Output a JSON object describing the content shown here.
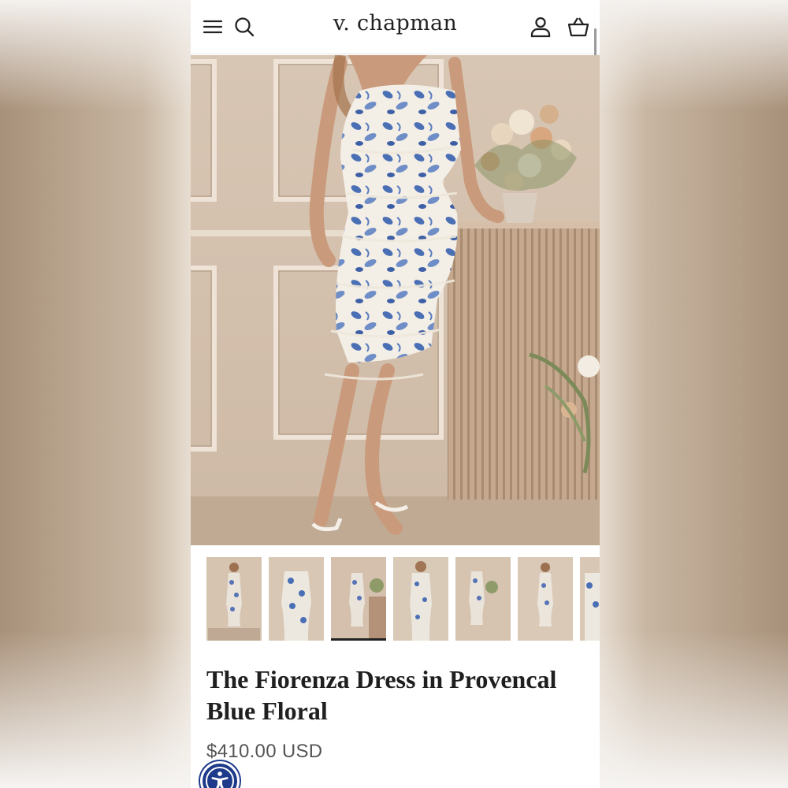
{
  "header": {
    "logo": "v. chapman",
    "icons": [
      "menu-icon",
      "search-icon",
      "account-icon",
      "cart-icon"
    ]
  },
  "product": {
    "title": "The Fiorenza Dress in Provencal Blue Floral",
    "price": "$410.00 USD",
    "selected_thumbnail_index": 2,
    "thumbnail_count": 7
  },
  "accessibility": {
    "icon": "accessibility-icon"
  },
  "colors": {
    "text_dark": "#1f1f1f",
    "price_gray": "#555555",
    "accessibility_blue": "#1e3a8a",
    "dress_blue": "#4a6fb5"
  }
}
